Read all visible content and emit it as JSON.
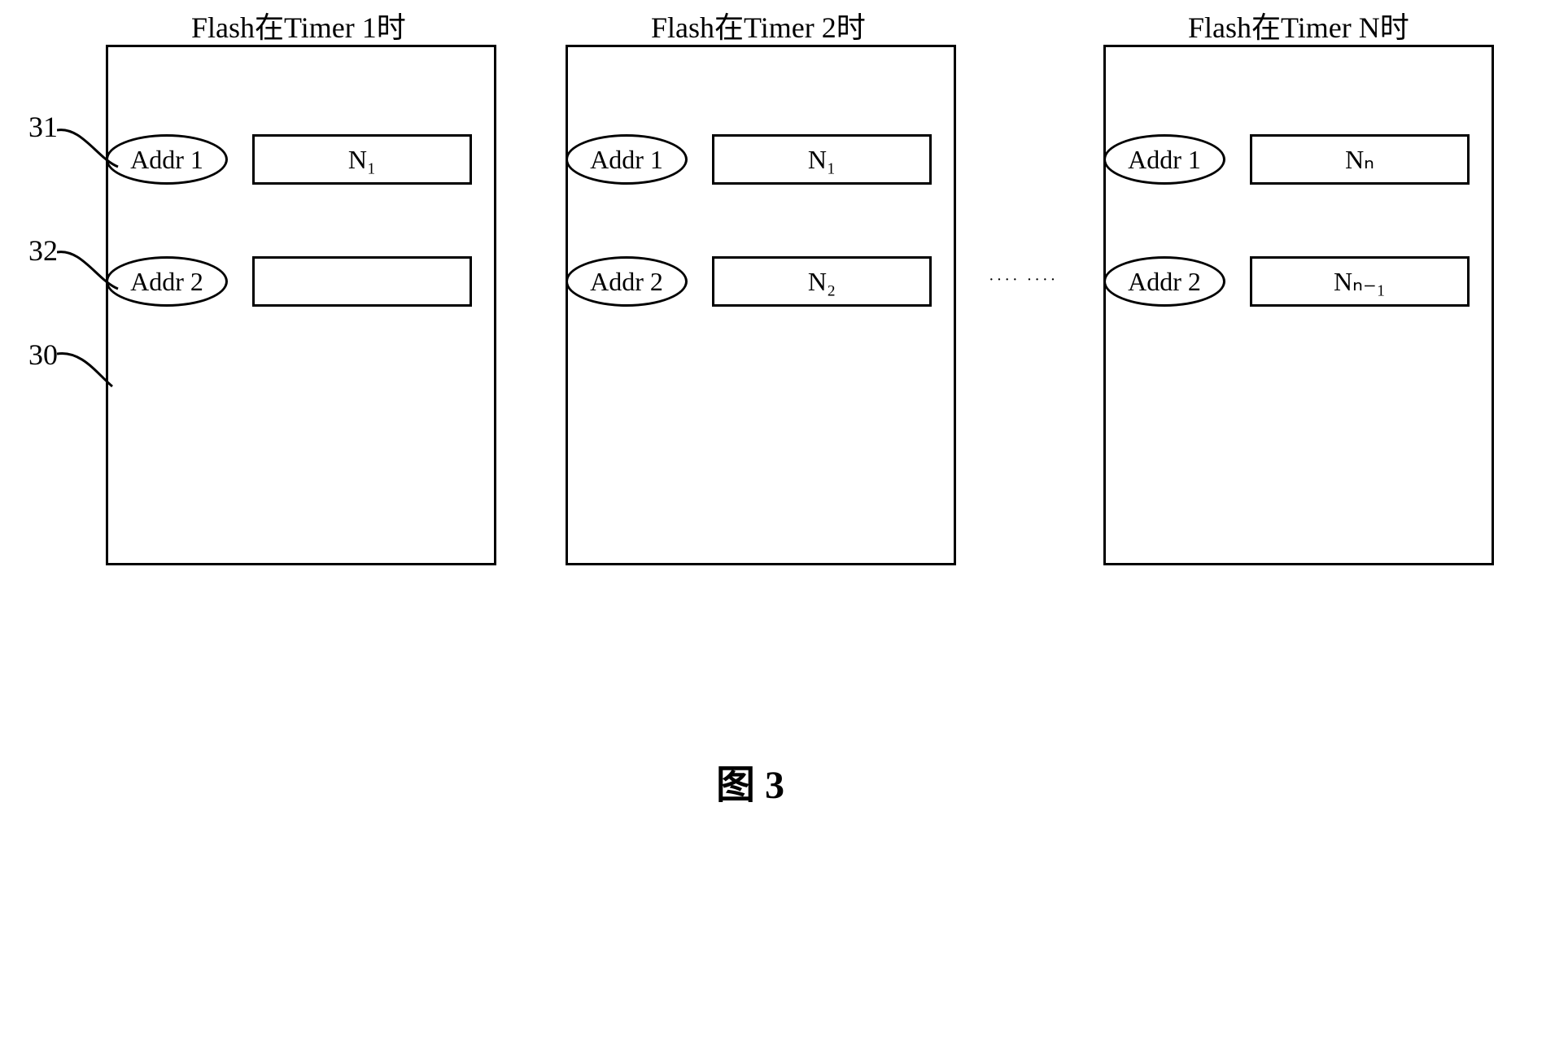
{
  "panels": [
    {
      "title": "Flash在Timer 1时",
      "addr1_label": "Addr 1",
      "addr1_value": "N₁",
      "addr2_label": "Addr 2",
      "addr2_value": ""
    },
    {
      "title": "Flash在Timer 2时",
      "addr1_label": "Addr 1",
      "addr1_value": "N₁",
      "addr2_label": "Addr 2",
      "addr2_value": "N₂"
    },
    {
      "title": "Flash在Timer N时",
      "addr1_label": "Addr 1",
      "addr1_value": "Nₙ",
      "addr2_label": "Addr 2",
      "addr2_value": "Nₙ₋₁"
    }
  ],
  "callouts": {
    "label31": "31",
    "label32": "32",
    "label30": "30"
  },
  "ellipsis": "····  ····",
  "figure_label": "图 3"
}
